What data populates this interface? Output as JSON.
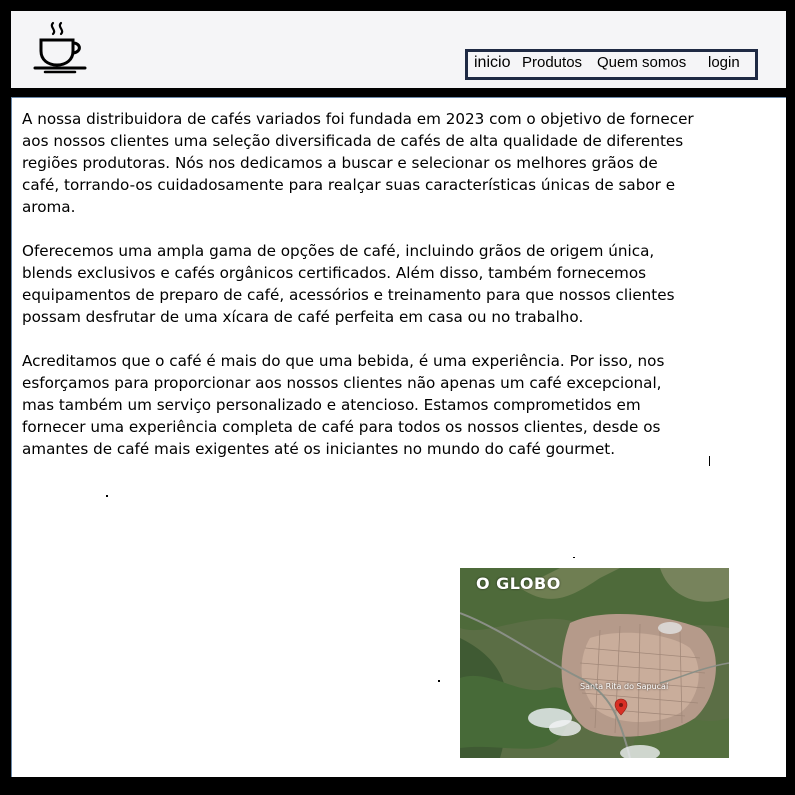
{
  "nav": {
    "items": [
      "inicio",
      "Produtos",
      "Quem somos",
      "login"
    ]
  },
  "content": {
    "paragraphs": [
      "A nossa distribuidora de cafés variados foi fundada em 2023 com o objetivo de fornecer aos nossos clientes uma seleção diversificada de cafés de alta qualidade de diferentes regiões produtoras. Nós nos dedicamos a buscar e selecionar os melhores grãos de café, torrando-os cuidadosamente para realçar suas características únicas de sabor e aroma.",
      "Oferecemos uma ampla gama de opções de café, incluindo grãos de origem única, blends exclusivos e cafés orgânicos certificados. Além disso, também fornecemos equipamentos de preparo de café, acessórios e treinamento para que nossos clientes possam desfrutar de uma xícara de café perfeita em casa ou no trabalho.",
      "Acreditamos que o café é mais do que uma bebida, é uma experiência. Por isso, nos esforçamos para proporcionar aos nossos clientes não apenas um café excepcional, mas também um serviço personalizado e atencioso. Estamos comprometidos em fornecer uma experiência completa de café para todos os nossos clientes, desde os amantes de café mais exigentes até os iniciantes no mundo do café gourmet."
    ]
  },
  "map": {
    "caption": "O GLOBO",
    "place_label": "Santa Rita do Sapucaí"
  },
  "icons": {
    "logo": "coffee-cup-icon",
    "map_marker": "map-pin-icon"
  },
  "colors": {
    "frame": "#000000",
    "header_bg": "#f5f5f7",
    "nav_border": "#1f2a44",
    "main_border": "#6a88a8",
    "map_pin": "#d93025"
  }
}
